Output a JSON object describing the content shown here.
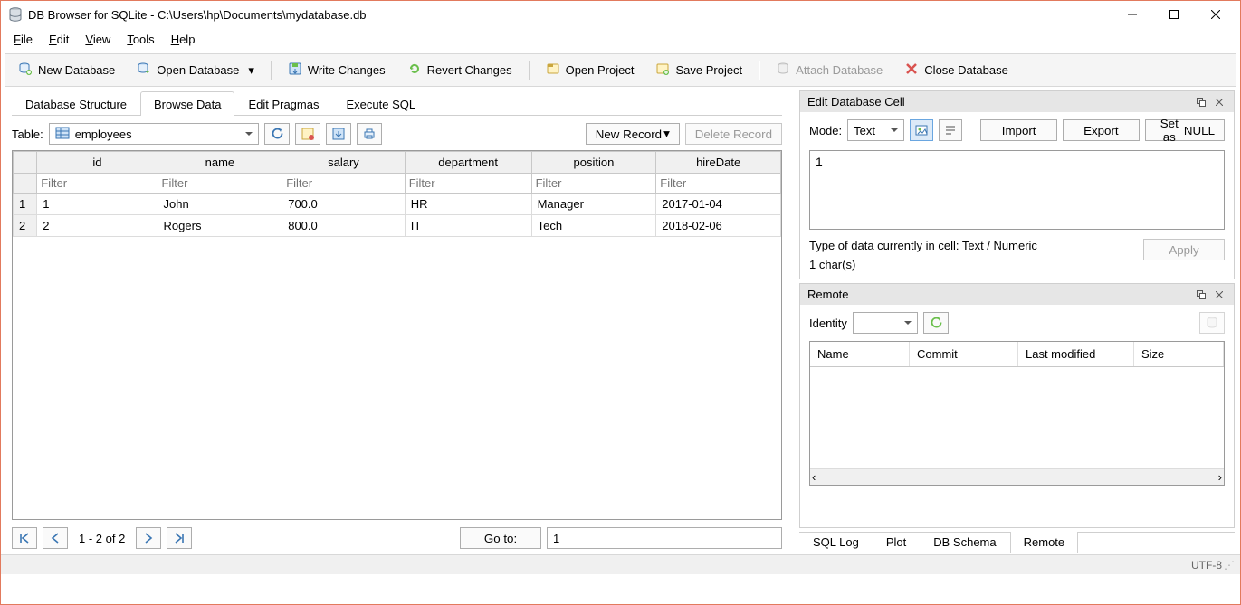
{
  "window": {
    "title": "DB Browser for SQLite - C:\\Users\\hp\\Documents\\mydatabase.db"
  },
  "menus": {
    "file": "File",
    "edit": "Edit",
    "view": "View",
    "tools": "Tools",
    "help": "Help"
  },
  "toolbar": {
    "new_db": "New Database",
    "open_db": "Open Database",
    "write_changes": "Write Changes",
    "revert_changes": "Revert Changes",
    "open_project": "Open Project",
    "save_project": "Save Project",
    "attach_db": "Attach Database",
    "close_db": "Close Database"
  },
  "tabs": {
    "structure": "Database Structure",
    "browse": "Browse Data",
    "pragmas": "Edit Pragmas",
    "sql": "Execute SQL"
  },
  "browse": {
    "table_label": "Table:",
    "table_select": "employees",
    "new_record": "New Record",
    "delete_record": "Delete Record",
    "filter_placeholder": "Filter",
    "columns": [
      "id",
      "name",
      "salary",
      "department",
      "position",
      "hireDate"
    ],
    "rows": [
      {
        "id": "1",
        "name": "John",
        "salary": "700.0",
        "department": "HR",
        "position": "Manager",
        "hireDate": "2017-01-04"
      },
      {
        "id": "2",
        "name": "Rogers",
        "salary": "800.0",
        "department": "IT",
        "position": "Tech",
        "hireDate": "2018-02-06"
      }
    ],
    "pager_text": "1 - 2 of 2",
    "goto_label": "Go to:",
    "goto_value": "1"
  },
  "edit_cell": {
    "title": "Edit Database Cell",
    "mode_label": "Mode:",
    "mode_value": "Text",
    "import": "Import",
    "export": "Export",
    "set_null": "Set as NULL",
    "value": "1",
    "type_info": "Type of data currently in cell: Text / Numeric",
    "char_count": "1 char(s)",
    "apply": "Apply"
  },
  "remote": {
    "title": "Remote",
    "identity_label": "Identity",
    "cols": {
      "name": "Name",
      "commit": "Commit",
      "last_modified": "Last modified",
      "size": "Size"
    }
  },
  "bottom_tabs": {
    "sql_log": "SQL Log",
    "plot": "Plot",
    "db_schema": "DB Schema",
    "remote": "Remote"
  },
  "status": {
    "encoding": "UTF-8"
  }
}
